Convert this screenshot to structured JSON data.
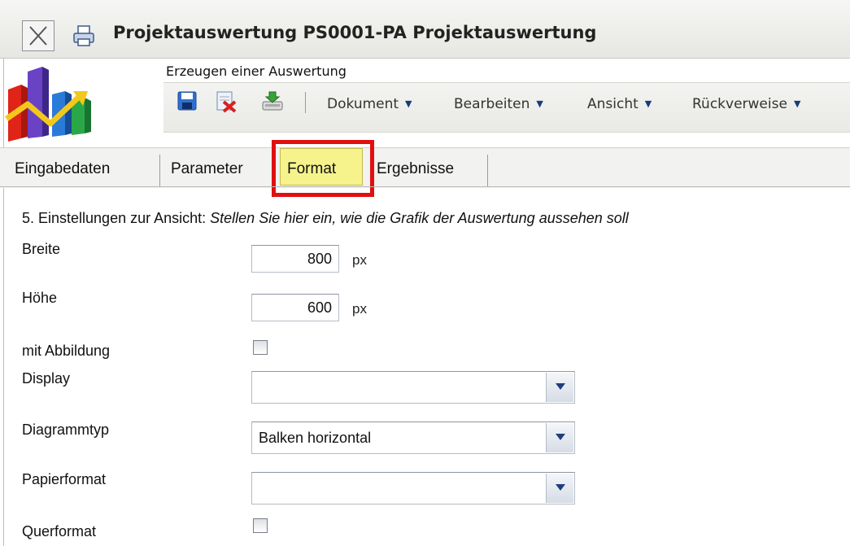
{
  "window": {
    "title": "Projektauswertung PS0001-PA Projektauswertung",
    "close_icon": "close-icon",
    "print_icon": "print-icon"
  },
  "app": {
    "logo_icon": "chart-logo-icon",
    "subtitle": "Erzeugen einer Auswertung"
  },
  "toolbar": {
    "icons": [
      "save-icon",
      "delete-icon",
      "export-icon"
    ],
    "menus": [
      {
        "label": "Dokument"
      },
      {
        "label": "Bearbeiten"
      },
      {
        "label": "Ansicht"
      },
      {
        "label": "Rückverweise"
      }
    ],
    "menu_arrow": "▼"
  },
  "tabs": {
    "items": [
      {
        "label": "Eingabedaten"
      },
      {
        "label": "Parameter"
      },
      {
        "label": "Format"
      },
      {
        "label": "Ergebnisse"
      }
    ],
    "active": "Format",
    "active_color": "#f7f38c",
    "highlight_color": "#e01010"
  },
  "section": {
    "heading": "5. Einstellungen zur Ansicht:",
    "hint": "Stellen Sie hier ein, wie die Grafik der Auswertung aussehen soll"
  },
  "form": {
    "breite": {
      "label": "Breite",
      "value": "800",
      "unit": "px"
    },
    "hoehe": {
      "label": "Höhe",
      "value": "600",
      "unit": "px"
    },
    "mit_abbildung": {
      "label": "mit Abbildung",
      "checked": false
    },
    "display": {
      "label": "Display",
      "value": ""
    },
    "diagrammtyp": {
      "label": "Diagrammtyp",
      "value": "Balken horizontal"
    },
    "papierformat": {
      "label": "Papierformat",
      "value": ""
    },
    "querformat": {
      "label": "Querformat",
      "checked": false
    }
  }
}
